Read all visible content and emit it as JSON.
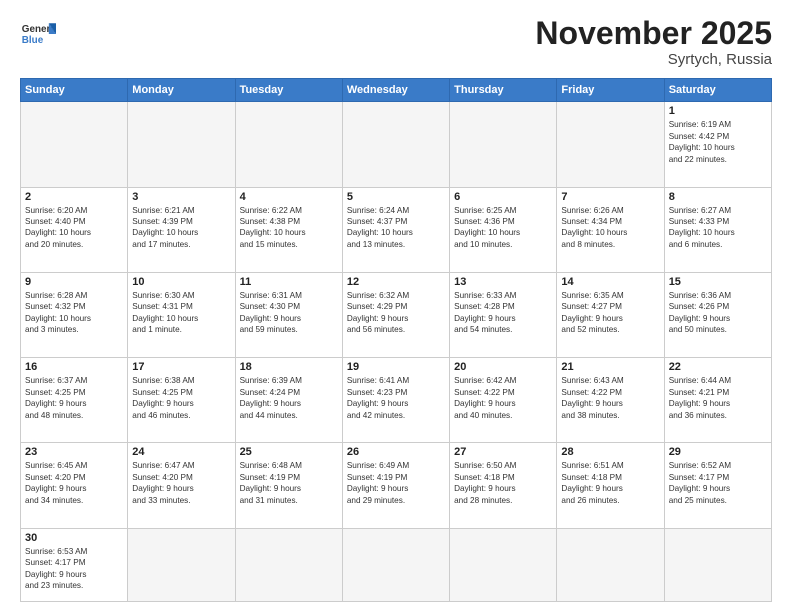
{
  "header": {
    "logo_general": "General",
    "logo_blue": "Blue",
    "month_year": "November 2025",
    "location": "Syrtych, Russia"
  },
  "weekdays": [
    "Sunday",
    "Monday",
    "Tuesday",
    "Wednesday",
    "Thursday",
    "Friday",
    "Saturday"
  ],
  "days": {
    "d1": {
      "num": "1",
      "info": "Sunrise: 6:19 AM\nSunset: 4:42 PM\nDaylight: 10 hours\nand 22 minutes."
    },
    "d2": {
      "num": "2",
      "info": "Sunrise: 6:20 AM\nSunset: 4:40 PM\nDaylight: 10 hours\nand 20 minutes."
    },
    "d3": {
      "num": "3",
      "info": "Sunrise: 6:21 AM\nSunset: 4:39 PM\nDaylight: 10 hours\nand 17 minutes."
    },
    "d4": {
      "num": "4",
      "info": "Sunrise: 6:22 AM\nSunset: 4:38 PM\nDaylight: 10 hours\nand 15 minutes."
    },
    "d5": {
      "num": "5",
      "info": "Sunrise: 6:24 AM\nSunset: 4:37 PM\nDaylight: 10 hours\nand 13 minutes."
    },
    "d6": {
      "num": "6",
      "info": "Sunrise: 6:25 AM\nSunset: 4:36 PM\nDaylight: 10 hours\nand 10 minutes."
    },
    "d7": {
      "num": "7",
      "info": "Sunrise: 6:26 AM\nSunset: 4:34 PM\nDaylight: 10 hours\nand 8 minutes."
    },
    "d8": {
      "num": "8",
      "info": "Sunrise: 6:27 AM\nSunset: 4:33 PM\nDaylight: 10 hours\nand 6 minutes."
    },
    "d9": {
      "num": "9",
      "info": "Sunrise: 6:28 AM\nSunset: 4:32 PM\nDaylight: 10 hours\nand 3 minutes."
    },
    "d10": {
      "num": "10",
      "info": "Sunrise: 6:30 AM\nSunset: 4:31 PM\nDaylight: 10 hours\nand 1 minute."
    },
    "d11": {
      "num": "11",
      "info": "Sunrise: 6:31 AM\nSunset: 4:30 PM\nDaylight: 9 hours\nand 59 minutes."
    },
    "d12": {
      "num": "12",
      "info": "Sunrise: 6:32 AM\nSunset: 4:29 PM\nDaylight: 9 hours\nand 56 minutes."
    },
    "d13": {
      "num": "13",
      "info": "Sunrise: 6:33 AM\nSunset: 4:28 PM\nDaylight: 9 hours\nand 54 minutes."
    },
    "d14": {
      "num": "14",
      "info": "Sunrise: 6:35 AM\nSunset: 4:27 PM\nDaylight: 9 hours\nand 52 minutes."
    },
    "d15": {
      "num": "15",
      "info": "Sunrise: 6:36 AM\nSunset: 4:26 PM\nDaylight: 9 hours\nand 50 minutes."
    },
    "d16": {
      "num": "16",
      "info": "Sunrise: 6:37 AM\nSunset: 4:25 PM\nDaylight: 9 hours\nand 48 minutes."
    },
    "d17": {
      "num": "17",
      "info": "Sunrise: 6:38 AM\nSunset: 4:25 PM\nDaylight: 9 hours\nand 46 minutes."
    },
    "d18": {
      "num": "18",
      "info": "Sunrise: 6:39 AM\nSunset: 4:24 PM\nDaylight: 9 hours\nand 44 minutes."
    },
    "d19": {
      "num": "19",
      "info": "Sunrise: 6:41 AM\nSunset: 4:23 PM\nDaylight: 9 hours\nand 42 minutes."
    },
    "d20": {
      "num": "20",
      "info": "Sunrise: 6:42 AM\nSunset: 4:22 PM\nDaylight: 9 hours\nand 40 minutes."
    },
    "d21": {
      "num": "21",
      "info": "Sunrise: 6:43 AM\nSunset: 4:22 PM\nDaylight: 9 hours\nand 38 minutes."
    },
    "d22": {
      "num": "22",
      "info": "Sunrise: 6:44 AM\nSunset: 4:21 PM\nDaylight: 9 hours\nand 36 minutes."
    },
    "d23": {
      "num": "23",
      "info": "Sunrise: 6:45 AM\nSunset: 4:20 PM\nDaylight: 9 hours\nand 34 minutes."
    },
    "d24": {
      "num": "24",
      "info": "Sunrise: 6:47 AM\nSunset: 4:20 PM\nDaylight: 9 hours\nand 33 minutes."
    },
    "d25": {
      "num": "25",
      "info": "Sunrise: 6:48 AM\nSunset: 4:19 PM\nDaylight: 9 hours\nand 31 minutes."
    },
    "d26": {
      "num": "26",
      "info": "Sunrise: 6:49 AM\nSunset: 4:19 PM\nDaylight: 9 hours\nand 29 minutes."
    },
    "d27": {
      "num": "27",
      "info": "Sunrise: 6:50 AM\nSunset: 4:18 PM\nDaylight: 9 hours\nand 28 minutes."
    },
    "d28": {
      "num": "28",
      "info": "Sunrise: 6:51 AM\nSunset: 4:18 PM\nDaylight: 9 hours\nand 26 minutes."
    },
    "d29": {
      "num": "29",
      "info": "Sunrise: 6:52 AM\nSunset: 4:17 PM\nDaylight: 9 hours\nand 25 minutes."
    },
    "d30": {
      "num": "30",
      "info": "Sunrise: 6:53 AM\nSunset: 4:17 PM\nDaylight: 9 hours\nand 23 minutes."
    }
  }
}
